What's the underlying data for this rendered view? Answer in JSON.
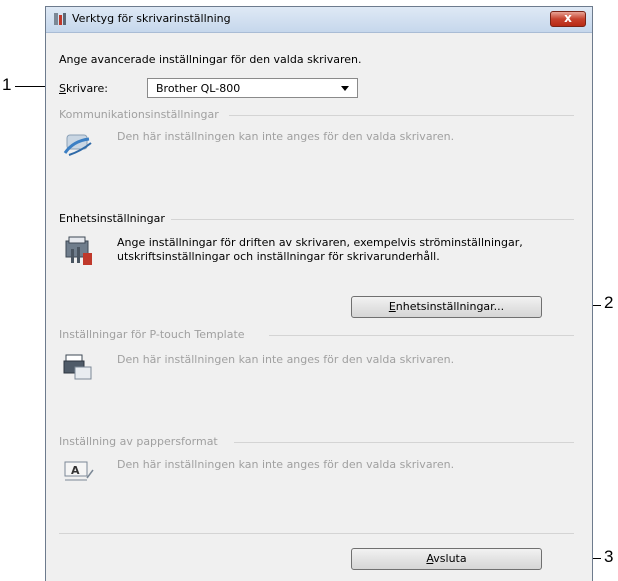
{
  "window": {
    "title": "Verktyg för skrivarinställning",
    "close_glyph": "x"
  },
  "intro_text": "Ange avancerade inställningar för den valda skrivaren.",
  "printer": {
    "label_accel": "S",
    "label_rest": "krivare:",
    "selected": "Brother QL-800"
  },
  "communication": {
    "heading": "Kommunikationsinställningar",
    "text": "Den här inställningen kan inte anges för den valda skrivaren."
  },
  "device": {
    "heading": "Enhetsinställningar",
    "text_line1": "Ange inställningar för driften av skrivaren, exempelvis ströminställningar,",
    "text_line2": "utskriftsinställningar och inställningar för skrivarunderhåll.",
    "button_accel": "E",
    "button_rest": "nhetsinställningar..."
  },
  "ptouch": {
    "heading": "Inställningar för P-touch Template",
    "text": "Den här inställningen kan inte anges för den valda skrivaren."
  },
  "paper": {
    "heading": "Inställning av pappersformat",
    "text": "Den här inställningen kan inte anges för den valda skrivaren."
  },
  "exit": {
    "accel": "A",
    "rest": "vsluta"
  },
  "callouts": {
    "one": "1",
    "two": "2",
    "three": "3"
  }
}
